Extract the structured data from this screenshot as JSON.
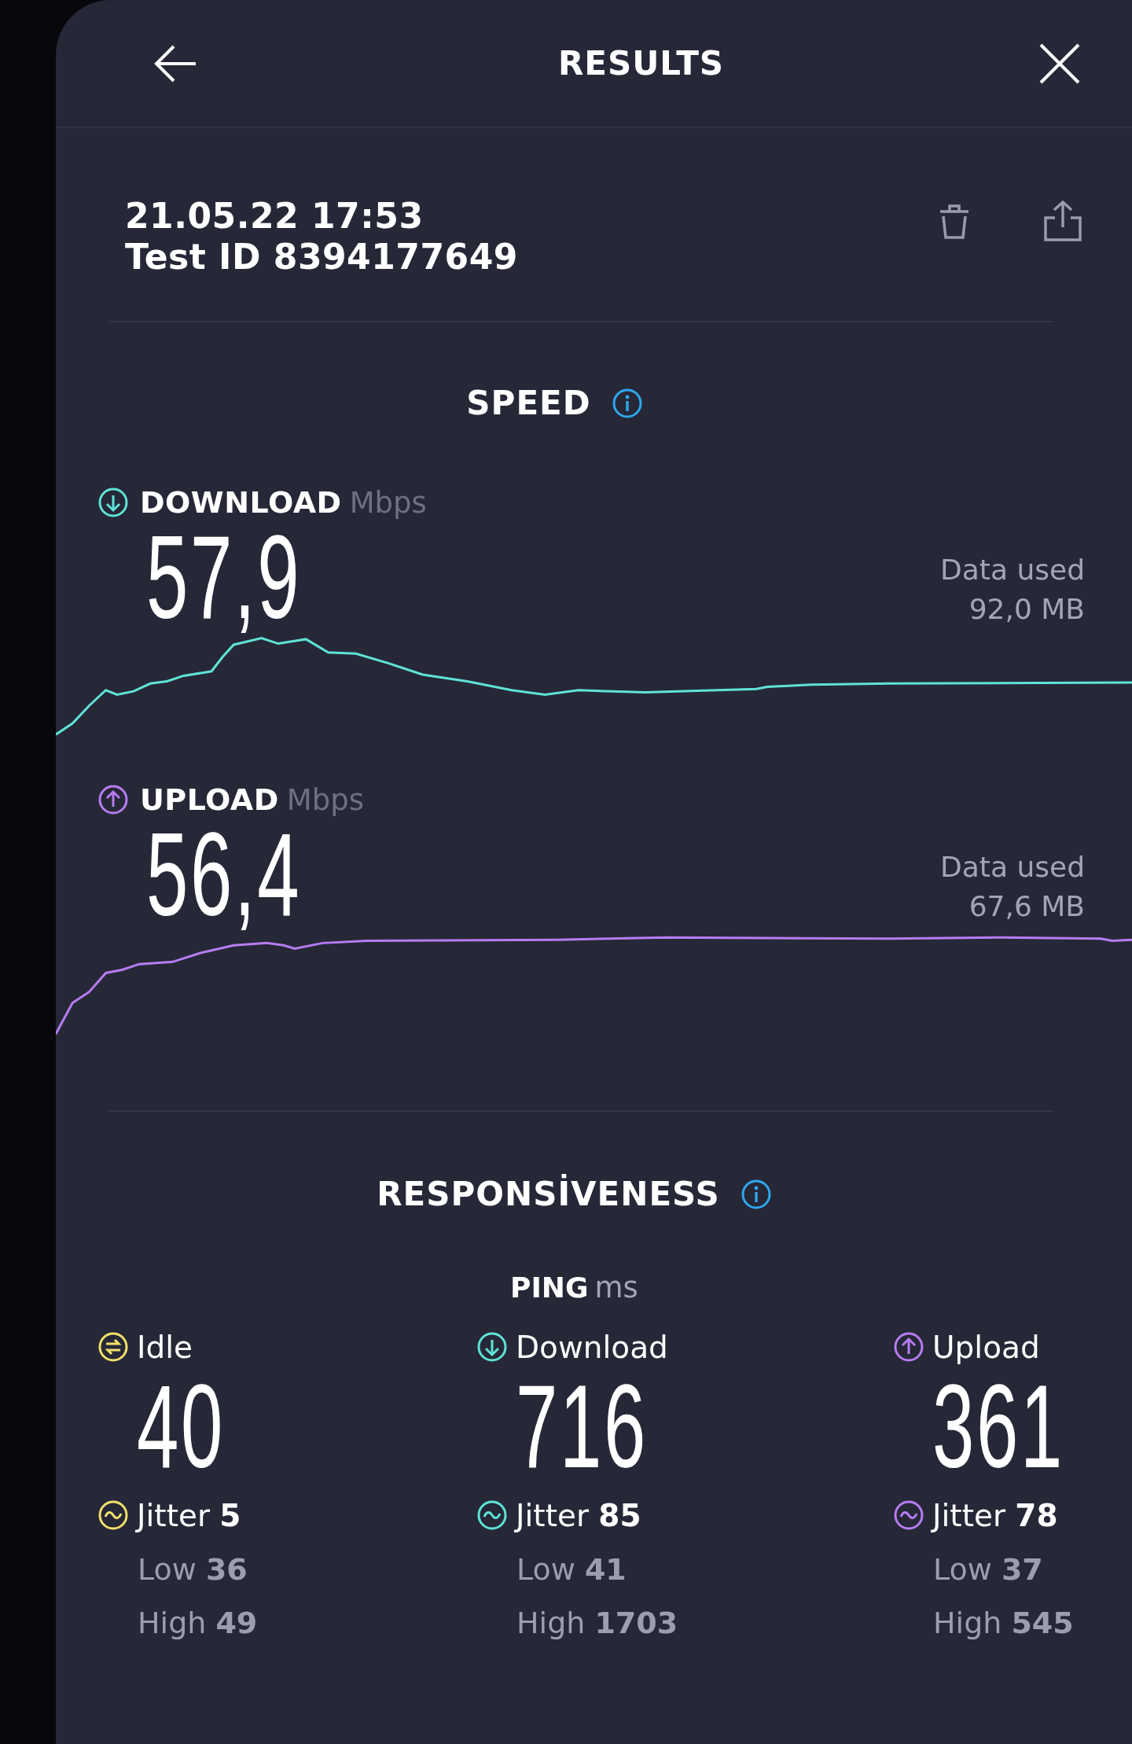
{
  "header": {
    "title": "RESULTS"
  },
  "test": {
    "datetime": "21.05.22 17:53",
    "test_id": "Test ID 8394177649"
  },
  "speed": {
    "heading": "SPEED",
    "metrics": [
      {
        "kind": "download",
        "label": "DOWNLOAD",
        "unit": "Mbps",
        "value": "57,9",
        "data_used_label": "Data used",
        "data_used": "92,0 MB"
      },
      {
        "kind": "upload",
        "label": "UPLOAD",
        "unit": "Mbps",
        "value": "56,4",
        "data_used_label": "Data used",
        "data_used": "67,6 MB"
      }
    ]
  },
  "responsiveness": {
    "heading": "RESPONSİVENESS",
    "ping_label": "PING",
    "ping_unit": "ms",
    "columns": [
      {
        "kind": "idle",
        "label": "Idle",
        "value": "40",
        "jitter_label": "Jitter",
        "jitter": "5",
        "low_label": "Low",
        "low": "36",
        "high_label": "High",
        "high": "49"
      },
      {
        "kind": "download",
        "label": "Download",
        "value": "716",
        "jitter_label": "Jitter",
        "jitter": "85",
        "low_label": "Low",
        "low": "41",
        "high_label": "High",
        "high": "1703"
      },
      {
        "kind": "upload",
        "label": "Upload",
        "value": "361",
        "jitter_label": "Jitter",
        "jitter": "78",
        "low_label": "Low",
        "low": "37",
        "high_label": "High",
        "high": "545"
      }
    ]
  }
}
